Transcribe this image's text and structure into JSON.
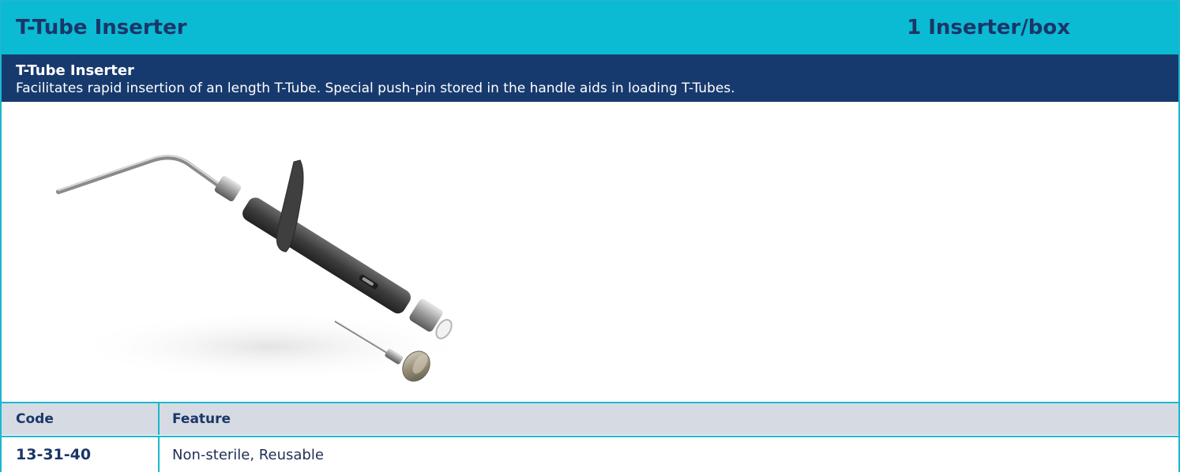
{
  "header": {
    "title": "T-Tube Inserter",
    "package": "1 Inserter/box",
    "bg_color": "#0bbad3"
  },
  "description": {
    "title": "T-Tube Inserter",
    "text": "Facilitates rapid insertion of an length T-Tube. Special push-pin stored in the handle aids in loading T-Tubes.",
    "bg_color": "#173a6e"
  },
  "product_image": {
    "icon": "t-tube-inserter-illustration"
  },
  "table": {
    "columns": [
      "Code",
      "Feature"
    ],
    "rows": [
      {
        "code": "13-31-40",
        "feature": "Non-sterile, Reusable"
      }
    ],
    "header_bg": "#d6dbe3",
    "border_color": "#1ab8d0"
  }
}
